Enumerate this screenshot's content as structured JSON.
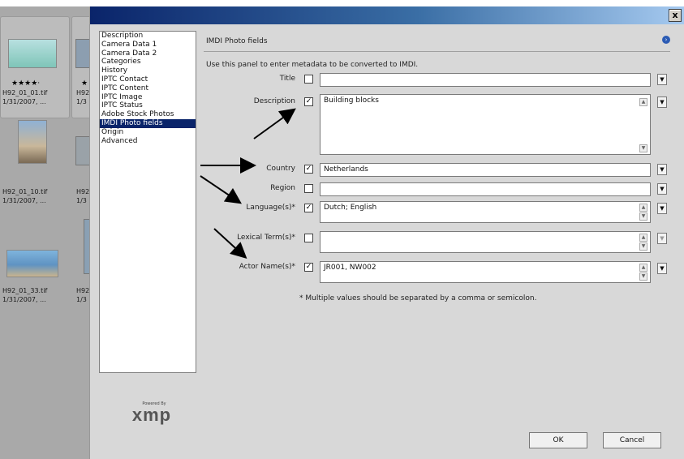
{
  "browser": {
    "thumbnails": [
      {
        "stars": "★★★★·",
        "name": "H92_01_01.tif",
        "date": "1/31/2007, ..."
      },
      {
        "name": "H92_01_10.tif",
        "date": "1/31/2007, ..."
      },
      {
        "name": "H92_01_33.tif",
        "date": "1/31/2007, ..."
      }
    ],
    "peeks": [
      {
        "stars": "★",
        "name": "H92",
        "date": "1/3"
      },
      {
        "name": "H92",
        "date": "1/3"
      },
      {
        "name": "H92",
        "date": "1/3"
      }
    ]
  },
  "dialog": {
    "close_label": "x",
    "categories": [
      "Description",
      "Camera Data 1",
      "Camera Data 2",
      "Categories",
      "History",
      "IPTC Contact",
      "IPTC Content",
      "IPTC Image",
      "IPTC Status",
      "Adobe Stock Photos",
      "IMDI Photo fields",
      "Origin",
      "Advanced"
    ],
    "selected_category": "IMDI Photo fields",
    "logo": {
      "powered": "Powered By",
      "word": "xmp"
    },
    "panel_title": "IMDI Photo fields",
    "intro": "Use this panel to enter metadata to be converted to IMDI.",
    "fields": [
      {
        "label": "Title",
        "checked": false,
        "value": ""
      },
      {
        "label": "Description",
        "checked": true,
        "value": "Building blocks"
      },
      {
        "label": "Country",
        "checked": true,
        "value": "Netherlands"
      },
      {
        "label": "Region",
        "checked": false,
        "value": ""
      },
      {
        "label": "Language(s)*",
        "checked": true,
        "value": "Dutch; English"
      },
      {
        "label": "Lexical Term(s)*",
        "checked": false,
        "value": ""
      },
      {
        "label": "Actor Name(s)*",
        "checked": true,
        "value": "JR001, NW002"
      }
    ],
    "check_mark": "✓",
    "note": "* Multiple values should be separated by a comma or semicolon.",
    "ok_label": "OK",
    "cancel_label": "Cancel"
  },
  "icons": {
    "dropdown": "chevron-down-icon",
    "close": "close-icon",
    "info": "info-icon"
  }
}
